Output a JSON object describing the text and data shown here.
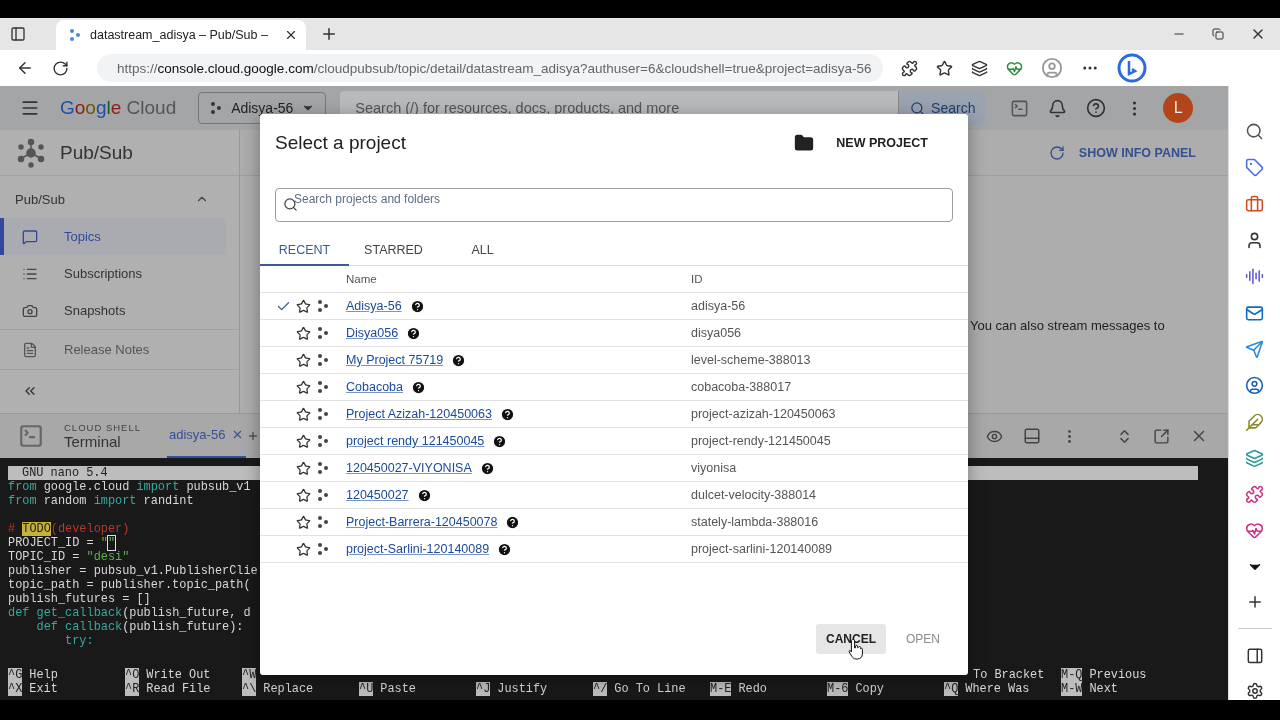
{
  "browser": {
    "tab": {
      "title": "datastream_adisya – Pub/Sub – "
    },
    "url": {
      "scheme": "https://",
      "host": "console.cloud.google.com",
      "path": "/cloudpubsub/topic/detail/datastream_adisya?authuser=6&cloudshell=true&project=adisya-56"
    }
  },
  "header": {
    "logo": {
      "brand": "Google",
      "product": "Cloud"
    },
    "project": "Adisya-56",
    "search": {
      "placeholder": "Search (/) for resources, docs, products, and more",
      "button": "Search"
    },
    "avatar": "L"
  },
  "product": {
    "title": "Pub/Sub"
  },
  "nav": {
    "section": "Pub/Sub",
    "expanded": true,
    "items": [
      {
        "label": "Topics",
        "kind": "chat",
        "selected": true
      },
      {
        "label": "Subscriptions",
        "kind": "list",
        "selected": false
      },
      {
        "label": "Snapshots",
        "kind": "snapshot",
        "selected": false
      }
    ],
    "footer_link": "Release Notes"
  },
  "content": {
    "info_button": "SHOW INFO PANEL",
    "text": "You can also stream messages to"
  },
  "cloud_shell": {
    "caption": "CLOUD SHELL",
    "title": "Terminal",
    "tabs": [
      {
        "label": "adisya-56",
        "selected": true
      }
    ]
  },
  "terminal": {
    "title": "GNU nano 5.4",
    "lines": [
      {
        "kind": "code",
        "tokens": [
          {
            "kind": "kw",
            "text": "from"
          },
          {
            "kind": "plain",
            "text": " google.cloud "
          },
          {
            "kind": "kw",
            "text": "import"
          },
          {
            "kind": "plain",
            "text": " pubsub_v1"
          }
        ]
      },
      {
        "kind": "code",
        "tokens": [
          {
            "kind": "kw",
            "text": "from"
          },
          {
            "kind": "plain",
            "text": " random "
          },
          {
            "kind": "kw",
            "text": "import"
          },
          {
            "kind": "plain",
            "text": " randint"
          }
        ]
      },
      {
        "kind": "blank"
      },
      {
        "kind": "code",
        "tokens": [
          {
            "kind": "comment",
            "text": "# "
          },
          {
            "kind": "todo",
            "text": "TODO"
          },
          {
            "kind": "comment",
            "text": "(developer)"
          }
        ]
      },
      {
        "kind": "code",
        "tokens": [
          {
            "kind": "plain",
            "text": "PROJECT_ID = "
          },
          {
            "kind": "string",
            "text": "\""
          },
          {
            "kind": "cursor",
            "text": "\""
          }
        ]
      },
      {
        "kind": "code",
        "tokens": [
          {
            "kind": "plain",
            "text": "TOPIC_ID = "
          },
          {
            "kind": "string",
            "text": "\"desi\""
          }
        ]
      },
      {
        "kind": "code",
        "tokens": [
          {
            "kind": "plain",
            "text": "publisher = pubsub_v1.PublisherClie"
          }
        ]
      },
      {
        "kind": "code",
        "tokens": [
          {
            "kind": "plain",
            "text": "topic_path = publisher.topic_path("
          }
        ]
      },
      {
        "kind": "code",
        "tokens": [
          {
            "kind": "plain",
            "text": "publish_futures = []"
          }
        ]
      },
      {
        "kind": "code",
        "tokens": [
          {
            "kind": "kw",
            "text": "def"
          },
          {
            "kind": "name",
            "text": " get_callback"
          },
          {
            "kind": "plain",
            "text": "(publish_future, d"
          }
        ]
      },
      {
        "kind": "code",
        "tokens": [
          {
            "kind": "kw",
            "text": "    def"
          },
          {
            "kind": "name",
            "text": " callback"
          },
          {
            "kind": "plain",
            "text": "(publish_future):"
          }
        ]
      },
      {
        "kind": "code",
        "tokens": [
          {
            "kind": "kw",
            "text": "        try:"
          }
        ]
      }
    ],
    "shortcut_rows": [
      {
        "start": [
          {
            "key": "^G",
            "label": "Help"
          },
          {
            "key": "^O",
            "label": "Write Out"
          },
          {
            "key": "^W"
          }
        ],
        "end": [
          {
            "label": "To Bracket"
          },
          {
            "key": "M-Q",
            "label": "Previous"
          }
        ]
      },
      {
        "start": [
          {
            "key": "^X",
            "label": "Exit"
          },
          {
            "key": "^R",
            "label": "Read File"
          },
          {
            "key": "^\\",
            "label": "Replace"
          },
          {
            "key": "^U",
            "label": "Paste"
          },
          {
            "key": "^J",
            "label": "Justify"
          },
          {
            "key": "^/",
            "label": "Go To Line"
          },
          {
            "key": "M-E",
            "label": "Redo"
          },
          {
            "key": "M-6",
            "label": "Copy"
          },
          {
            "key": "^Q",
            "label": "Where Was"
          },
          {
            "key": "M-W",
            "label": "Next"
          }
        ]
      }
    ]
  },
  "dialog": {
    "title": "Select a project",
    "new_project": "NEW PROJECT",
    "search": {
      "placeholder": "Search projects and folders"
    },
    "tabs": [
      {
        "label": "RECENT",
        "selected": true
      },
      {
        "label": "STARRED",
        "selected": false
      },
      {
        "label": "ALL",
        "selected": false
      }
    ],
    "columns": [
      "Name",
      "ID"
    ],
    "rows": [
      {
        "name": "Adisya-56",
        "id": "adisya-56",
        "selected": true,
        "starred": false
      },
      {
        "name": "Disya056",
        "id": "disya056",
        "selected": false,
        "starred": false
      },
      {
        "name": "My Project 75719",
        "id": "level-scheme-388013",
        "selected": false,
        "starred": false
      },
      {
        "name": "Cobacoba",
        "id": "cobacoba-388017",
        "selected": false,
        "starred": false
      },
      {
        "name": "Project Azizah-120450063",
        "id": "project-azizah-120450063",
        "selected": false,
        "starred": false
      },
      {
        "name": "project rendy 121450045",
        "id": "project-rendy-121450045",
        "selected": false,
        "starred": false
      },
      {
        "name": "120450027-VIYONISA",
        "id": "viyonisa",
        "selected": false,
        "starred": false
      },
      {
        "name": "120450027",
        "id": "dulcet-velocity-388014",
        "selected": false,
        "starred": false
      },
      {
        "name": "Project-Barrera-120450078",
        "id": "stately-lambda-388016",
        "selected": false,
        "starred": false
      },
      {
        "name": "project-Sarlini-120140089",
        "id": "project-sarlini-120140089",
        "selected": false,
        "starred": false
      }
    ],
    "buttons": [
      {
        "label": "CANCEL",
        "hovered": true,
        "disabled": false
      },
      {
        "label": "OPEN",
        "hovered": false,
        "disabled": true
      }
    ]
  }
}
